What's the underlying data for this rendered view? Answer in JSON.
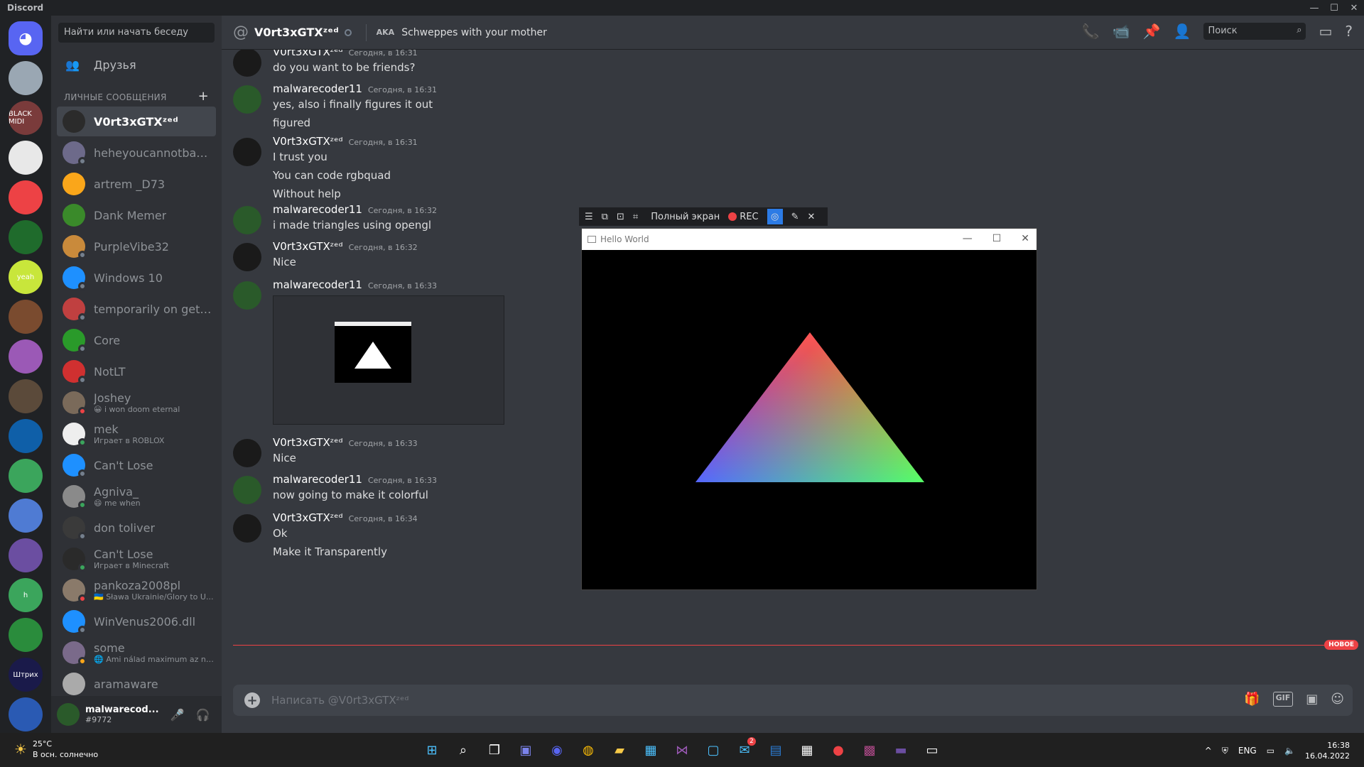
{
  "window": {
    "title": "Discord",
    "controls": [
      "—",
      "☐",
      "✕"
    ]
  },
  "guilds": [
    {
      "bg": "#5865f2",
      "label": "",
      "home": true
    },
    {
      "bg": "#9aa7b3"
    },
    {
      "bg": "#7a3b3b",
      "label": "BLACK MIDI"
    },
    {
      "bg": "#e8e8e8"
    },
    {
      "bg": "#ed4245"
    },
    {
      "bg": "#1f6b2c"
    },
    {
      "bg": "#c8e63b",
      "label": "yeah"
    },
    {
      "bg": "#7a4b2f"
    },
    {
      "bg": "#9b59b6"
    },
    {
      "bg": "#5b4a3a"
    },
    {
      "bg": "#0f5fa8"
    },
    {
      "bg": "#3ba55c"
    },
    {
      "bg": "#4f7bd3"
    },
    {
      "bg": "#6b4ea1"
    },
    {
      "bg": "#3ba55c",
      "label": "h"
    },
    {
      "bg": "#2a8c3c"
    },
    {
      "bg": "#1a1a4a",
      "label": "Штрих"
    },
    {
      "bg": "#2a5ab3"
    }
  ],
  "dm": {
    "search_placeholder": "Найти или начать беседу",
    "friends_label": "Друзья",
    "section_label": "ЛИЧНЫЕ СООБЩЕНИЯ",
    "items": [
      {
        "name": "V0rt3xGTXᶻᵉᵈ",
        "sub": "",
        "color": "#2b2b2b",
        "status": "",
        "active": true
      },
      {
        "name": "heheyoucannotbanme...",
        "sub": "",
        "color": "#6d6a8a",
        "status": "#747f8d"
      },
      {
        "name": "artrem _D73",
        "sub": "",
        "color": "#faa61a",
        "status": ""
      },
      {
        "name": "Dank Memer",
        "sub": "",
        "color": "#3a8a2a",
        "status": ""
      },
      {
        "name": "PurpleVibe32",
        "sub": "",
        "color": "#c98a3b",
        "status": "#747f8d"
      },
      {
        "name": "Windows 10",
        "sub": "",
        "color": "#1e90ff",
        "status": "#747f8d"
      },
      {
        "name": "temporarily on getreal ...",
        "sub": "",
        "color": "#c04040",
        "status": "#747f8d"
      },
      {
        "name": "Core",
        "sub": "",
        "color": "#2a9a2a",
        "status": "#747f8d"
      },
      {
        "name": "NotLT",
        "sub": "",
        "color": "#d03030",
        "status": "#747f8d"
      },
      {
        "name": "Joshey",
        "sub": "😀 i won doom eternal",
        "color": "#7a6a5a",
        "status": "#ed4245"
      },
      {
        "name": "mek",
        "sub": "Играет в ROBLOX",
        "color": "#eeeeee",
        "status": "#3ba55c"
      },
      {
        "name": "Can't Lose",
        "sub": "",
        "color": "#1e90ff",
        "status": "#747f8d"
      },
      {
        "name": "Agniva_",
        "sub": "😄 me when",
        "color": "#8a8a8a",
        "status": "#3ba55c"
      },
      {
        "name": "don toliver",
        "sub": "",
        "color": "#3a3a3a",
        "status": "#747f8d"
      },
      {
        "name": "Can't Lose",
        "sub": "Играет в Minecraft",
        "color": "#2a2a2a",
        "status": "#3ba55c"
      },
      {
        "name": "pankoza2008pl",
        "sub": "🇺🇦 Sława Ukrainie/Glory to U...",
        "color": "#8a7a6a",
        "status": "#ed4245"
      },
      {
        "name": "WinVenus2006.dll",
        "sub": "",
        "color": "#1e90ff",
        "status": "#747f8d"
      },
      {
        "name": "some",
        "sub": "🌐 Ami nálad maximum az nál...",
        "color": "#7a6a8a",
        "status": "#faa61a"
      },
      {
        "name": "aramaware",
        "sub": "",
        "color": "#aaaaaa",
        "status": ""
      }
    ]
  },
  "user": {
    "name": "malwarecod...",
    "tag": "#9772"
  },
  "channel": {
    "name": "V0rt3xGTXᶻᵉᵈ",
    "aka_label": "AKA",
    "aka_value": "Schweppes with your mother",
    "search_placeholder": "Поиск"
  },
  "messages": [
    {
      "author": "V0rt3xGTXᶻᵉᵈ",
      "time": "Сегодня, в 16:31",
      "lines": [
        "do you want to be friends?"
      ],
      "av": "#1a1a1a"
    },
    {
      "author": "malwarecoder11",
      "time": "Сегодня, в 16:31",
      "lines": [
        "yes, also i finally figures it out",
        "figured"
      ],
      "av": "#2a5a2a"
    },
    {
      "author": "V0rt3xGTXᶻᵉᵈ",
      "time": "Сегодня, в 16:31",
      "lines": [
        "I trust you",
        "You can code rgbquad",
        "Without help"
      ],
      "av": "#1a1a1a"
    },
    {
      "author": "malwarecoder11",
      "time": "Сегодня, в 16:32",
      "lines": [
        "i made triangles using opengl"
      ],
      "av": "#2a5a2a"
    },
    {
      "author": "V0rt3xGTXᶻᵉᵈ",
      "time": "Сегодня, в 16:32",
      "lines": [
        "Nice"
      ],
      "av": "#1a1a1a"
    },
    {
      "author": "malwarecoder11",
      "time": "Сегодня, в 16:33",
      "lines": [],
      "av": "#2a5a2a",
      "image": true
    },
    {
      "author": "V0rt3xGTXᶻᵉᵈ",
      "time": "Сегодня, в 16:33",
      "lines": [
        "Nice"
      ],
      "av": "#1a1a1a"
    },
    {
      "author": "malwarecoder11",
      "time": "Сегодня, в 16:33",
      "lines": [
        "now going to make it colorful"
      ],
      "av": "#2a5a2a"
    },
    {
      "author": "V0rt3xGTXᶻᵉᵈ",
      "time": "Сегодня, в 16:34",
      "lines": [
        "Ok",
        "Make it Transparently"
      ],
      "av": "#1a1a1a"
    }
  ],
  "new_badge": "НОВОЕ",
  "composer": {
    "placeholder": "Написать @V0rt3xGTXᶻᵉᵈ",
    "gif": "GIF"
  },
  "overlay": {
    "fullscreen_label": "Полный экран",
    "rec_label": "REC"
  },
  "hello_window": {
    "title": "Hello World"
  },
  "taskbar": {
    "temp": "25°C",
    "weather": "В осн. солнечно",
    "lang": "ENG",
    "time": "16:38",
    "date": "16.04.2022",
    "badge": "2"
  }
}
